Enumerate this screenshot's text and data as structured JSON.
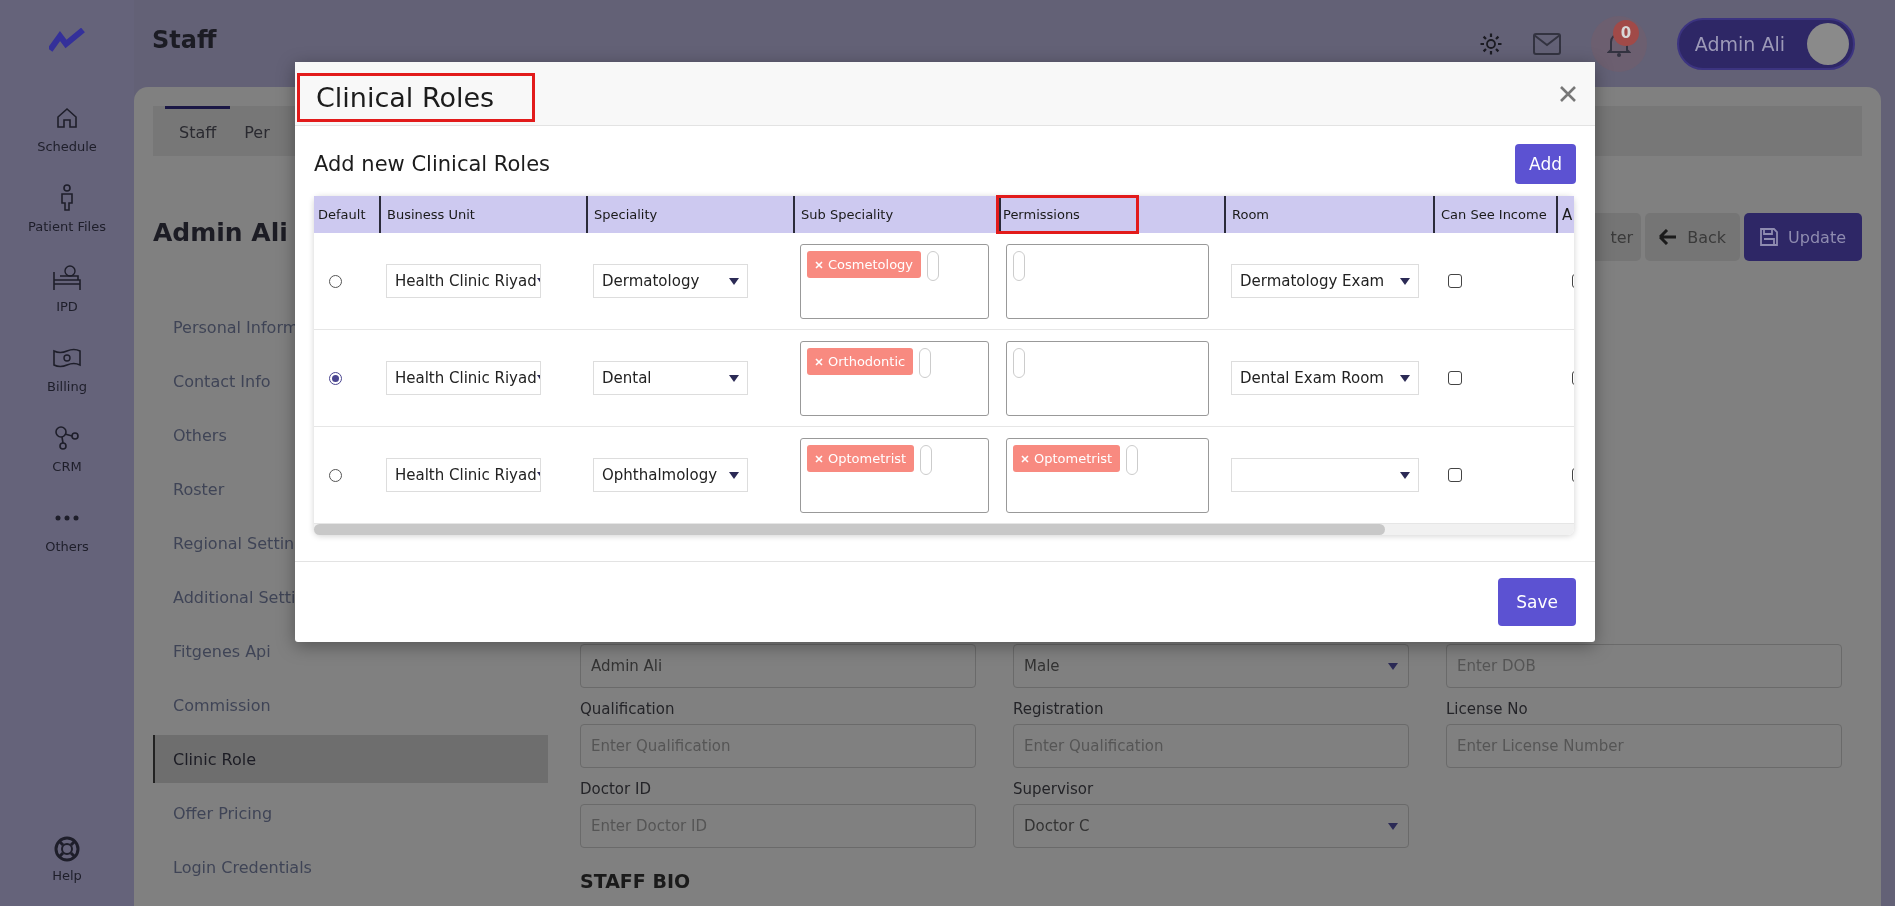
{
  "sidebar": {
    "items": [
      {
        "label": "Schedule",
        "kind": "home"
      },
      {
        "label": "Patient Files",
        "kind": "person"
      },
      {
        "label": "IPD",
        "kind": "bed"
      },
      {
        "label": "Billing",
        "kind": "money"
      },
      {
        "label": "CRM",
        "kind": "network"
      },
      {
        "label": "Others",
        "kind": "dots"
      }
    ],
    "help": {
      "label": "Help"
    }
  },
  "header": {
    "title": "Staff",
    "notification_count": "0",
    "user_name": "Admin Ali"
  },
  "tabs": [
    {
      "label": "Staff",
      "selected": true
    },
    {
      "label": "Per",
      "selected": false
    }
  ],
  "profile_name": "Admin Ali",
  "menu": [
    {
      "label": "Personal Inform",
      "selected": false
    },
    {
      "label": "Contact Info",
      "selected": false
    },
    {
      "label": "Others",
      "selected": false
    },
    {
      "label": "Roster",
      "selected": false
    },
    {
      "label": "Regional Settin",
      "selected": false
    },
    {
      "label": "Additional Setti",
      "selected": false
    },
    {
      "label": "Fitgenes Api",
      "selected": false
    },
    {
      "label": "Commission",
      "selected": false
    },
    {
      "label": "Clinic Role",
      "selected": true
    },
    {
      "label": "Offer Pricing",
      "selected": false
    },
    {
      "label": "Login Credentials",
      "selected": false
    }
  ],
  "actions": [
    {
      "label": "ter",
      "kind": "plain"
    },
    {
      "label": "Back",
      "kind": "back"
    },
    {
      "label": "Update",
      "kind": "save"
    }
  ],
  "form": {
    "fields": [
      {
        "kind": "input",
        "value": "Admin Ali"
      },
      {
        "kind": "select",
        "value": "Male"
      },
      {
        "kind": "input",
        "placeholder": "Enter DOB"
      },
      {
        "kind": "input",
        "label": "Qualification",
        "placeholder": "Enter Qualification"
      },
      {
        "kind": "input",
        "label": "Registration",
        "placeholder": "Enter Qualification"
      },
      {
        "kind": "input",
        "label": "License No",
        "placeholder": "Enter License Number"
      },
      {
        "kind": "input",
        "label": "Doctor ID",
        "placeholder": "Enter Doctor ID"
      },
      {
        "kind": "select",
        "label": "Supervisor",
        "value": "Doctor C"
      }
    ],
    "section_heading": "STAFF BIO"
  },
  "modal": {
    "title": "Clinical Roles",
    "title_highlighted": true,
    "subtitle": "Add new Clinical Roles",
    "add_button": "Add",
    "save_button": "Save",
    "columns": [
      {
        "label": "Default",
        "highlighted": false
      },
      {
        "label": "Business Unit",
        "highlighted": false
      },
      {
        "label": "Speciality",
        "highlighted": false
      },
      {
        "label": "Sub Speciality",
        "highlighted": false
      },
      {
        "label": "Permissions",
        "highlighted": true
      },
      {
        "label": "Room",
        "highlighted": false
      },
      {
        "label": "Can See Income",
        "highlighted": false
      },
      {
        "label": "A",
        "highlighted": false
      }
    ],
    "rows": [
      {
        "default": false,
        "business_unit": "Health Clinic Riyad",
        "speciality": "Dermatology",
        "sub_speciality": [
          "Cosmetology"
        ],
        "room": "Dermatology Exam",
        "can_see_income": false,
        "column_8": false
      },
      {
        "default": true,
        "business_unit": "Health Clinic Riyad",
        "speciality": "Dental",
        "sub_speciality": [
          "Orthodontic"
        ],
        "room": "Dental Exam Room",
        "can_see_income": false,
        "column_8": false
      },
      {
        "default": false,
        "business_unit": "Health Clinic Riyad",
        "speciality": "Ophthalmology",
        "sub_speciality": [
          "Optometrist"
        ],
        "permissions": [
          "Optometrist"
        ],
        "can_see_income": false,
        "column_8": false
      }
    ]
  }
}
